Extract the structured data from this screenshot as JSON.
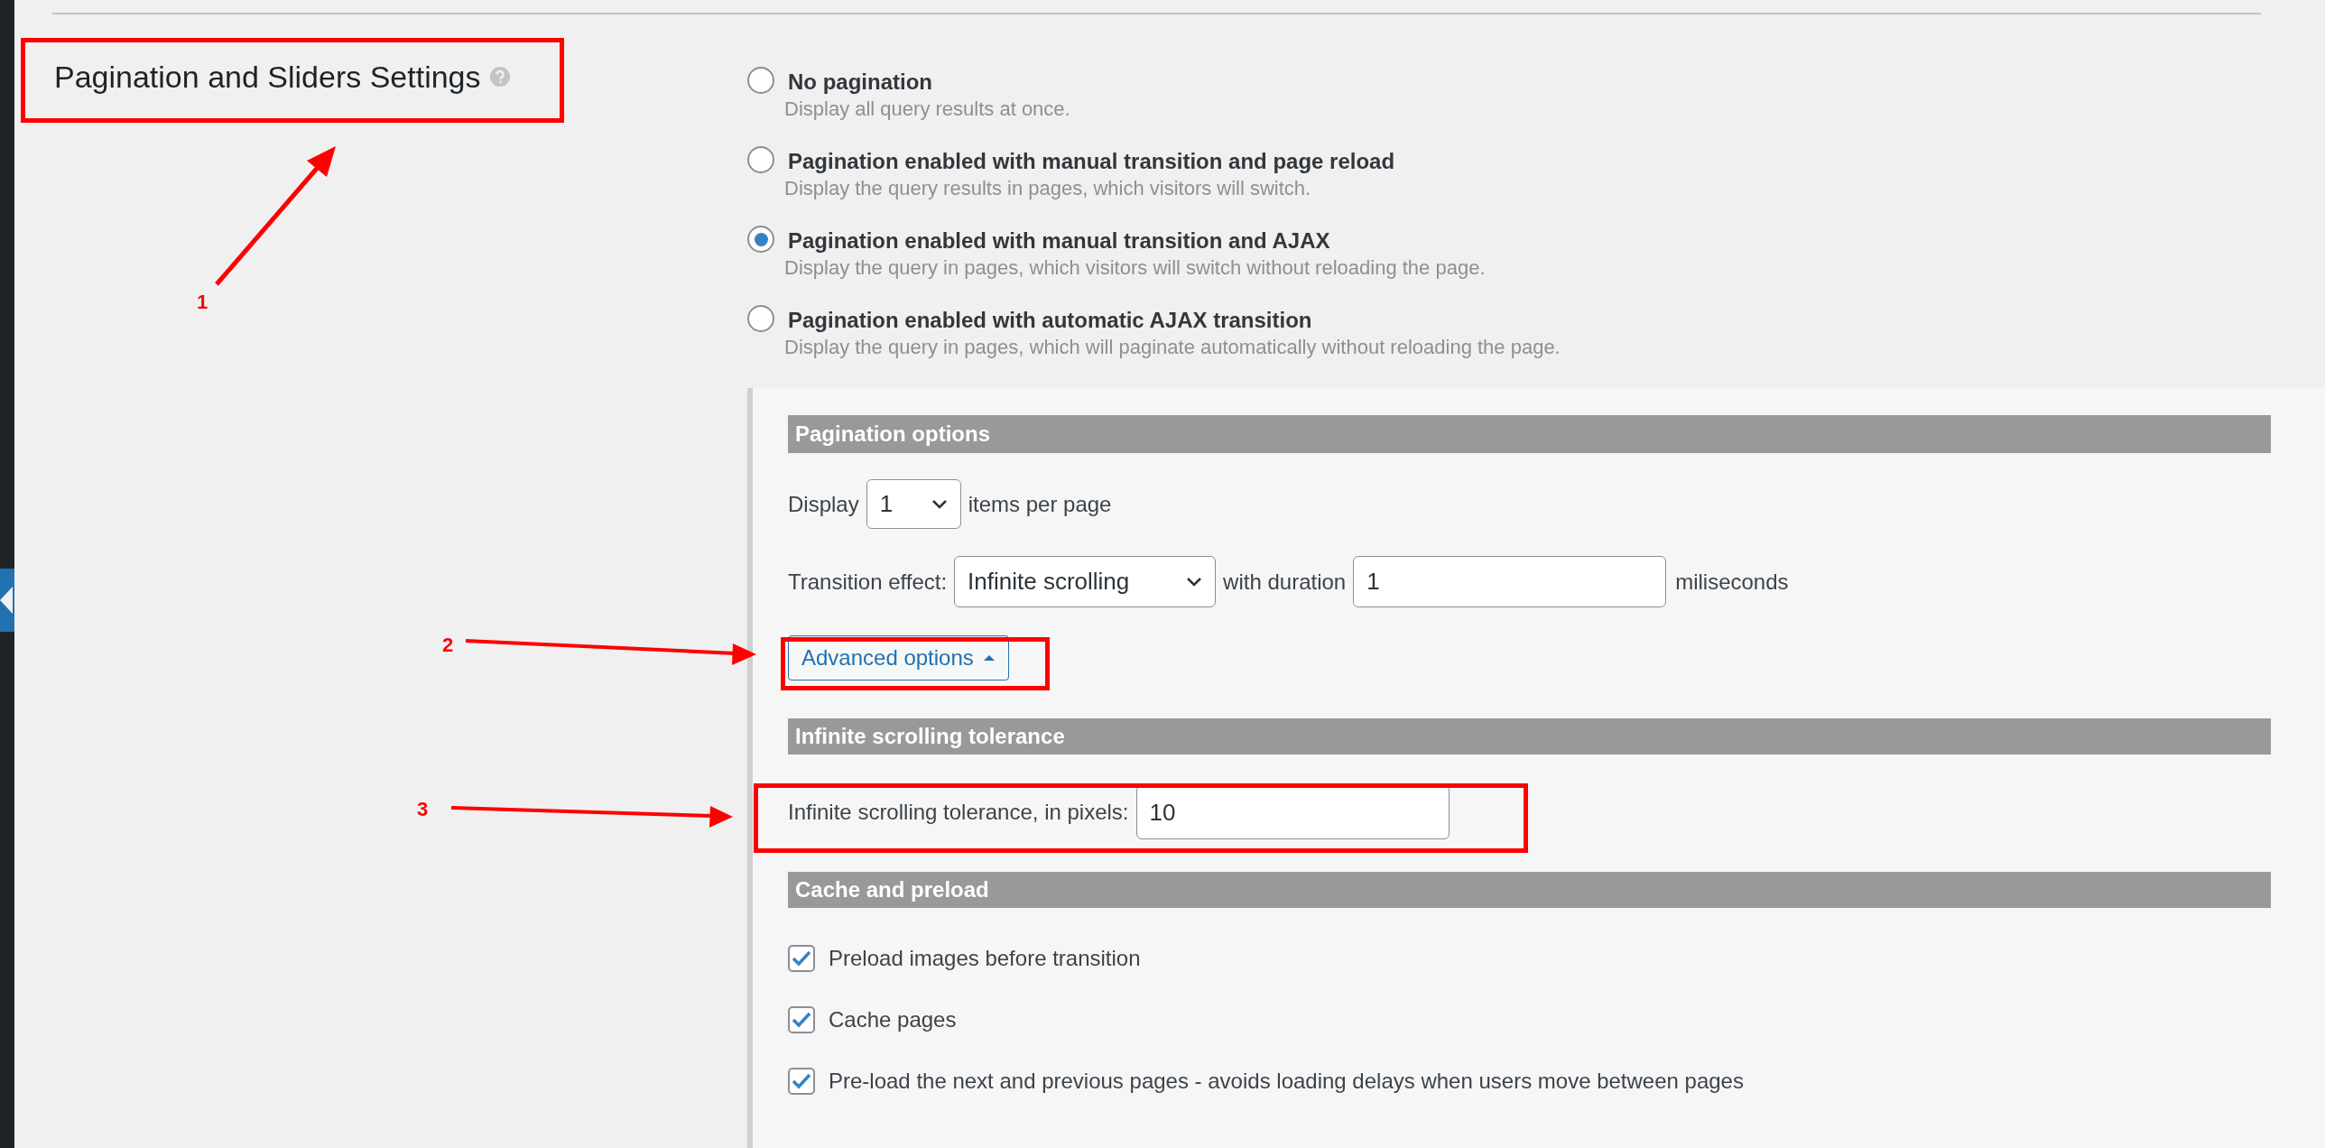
{
  "heading": {
    "title": "Pagination and Sliders Settings"
  },
  "pagination_modes": [
    {
      "label": "No pagination",
      "description": "Display all query results at once.",
      "selected": false
    },
    {
      "label": "Pagination enabled with manual transition and page reload",
      "description": "Display the query results in pages, which visitors will switch.",
      "selected": false
    },
    {
      "label": "Pagination enabled with manual transition and AJAX",
      "description": "Display the query in pages, which visitors will switch without reloading the page.",
      "selected": true
    },
    {
      "label": "Pagination enabled with automatic AJAX transition",
      "description": "Display the query in pages, which will paginate automatically without reloading the page.",
      "selected": false
    }
  ],
  "pagination_options": {
    "header": "Pagination options",
    "display_label": "Display",
    "items_per_page": "1",
    "items_suffix": "items per page",
    "transition_label": "Transition effect:",
    "transition_effect": "Infinite scrolling",
    "duration_label": "with duration",
    "duration": "1",
    "duration_unit": "miliseconds",
    "advanced_button": "Advanced options",
    "advanced_expanded": true
  },
  "tolerance": {
    "header": "Infinite scrolling tolerance",
    "label": "Infinite scrolling tolerance, in pixels:",
    "value": "10"
  },
  "cache": {
    "header": "Cache and preload",
    "options": [
      {
        "label": "Preload images before transition",
        "checked": true
      },
      {
        "label": "Cache pages",
        "checked": true
      },
      {
        "label": "Pre-load the next and previous pages - avoids loading delays when users move between pages",
        "checked": true
      }
    ]
  },
  "annotations": [
    {
      "number": "1"
    },
    {
      "number": "2"
    },
    {
      "number": "3"
    }
  ]
}
